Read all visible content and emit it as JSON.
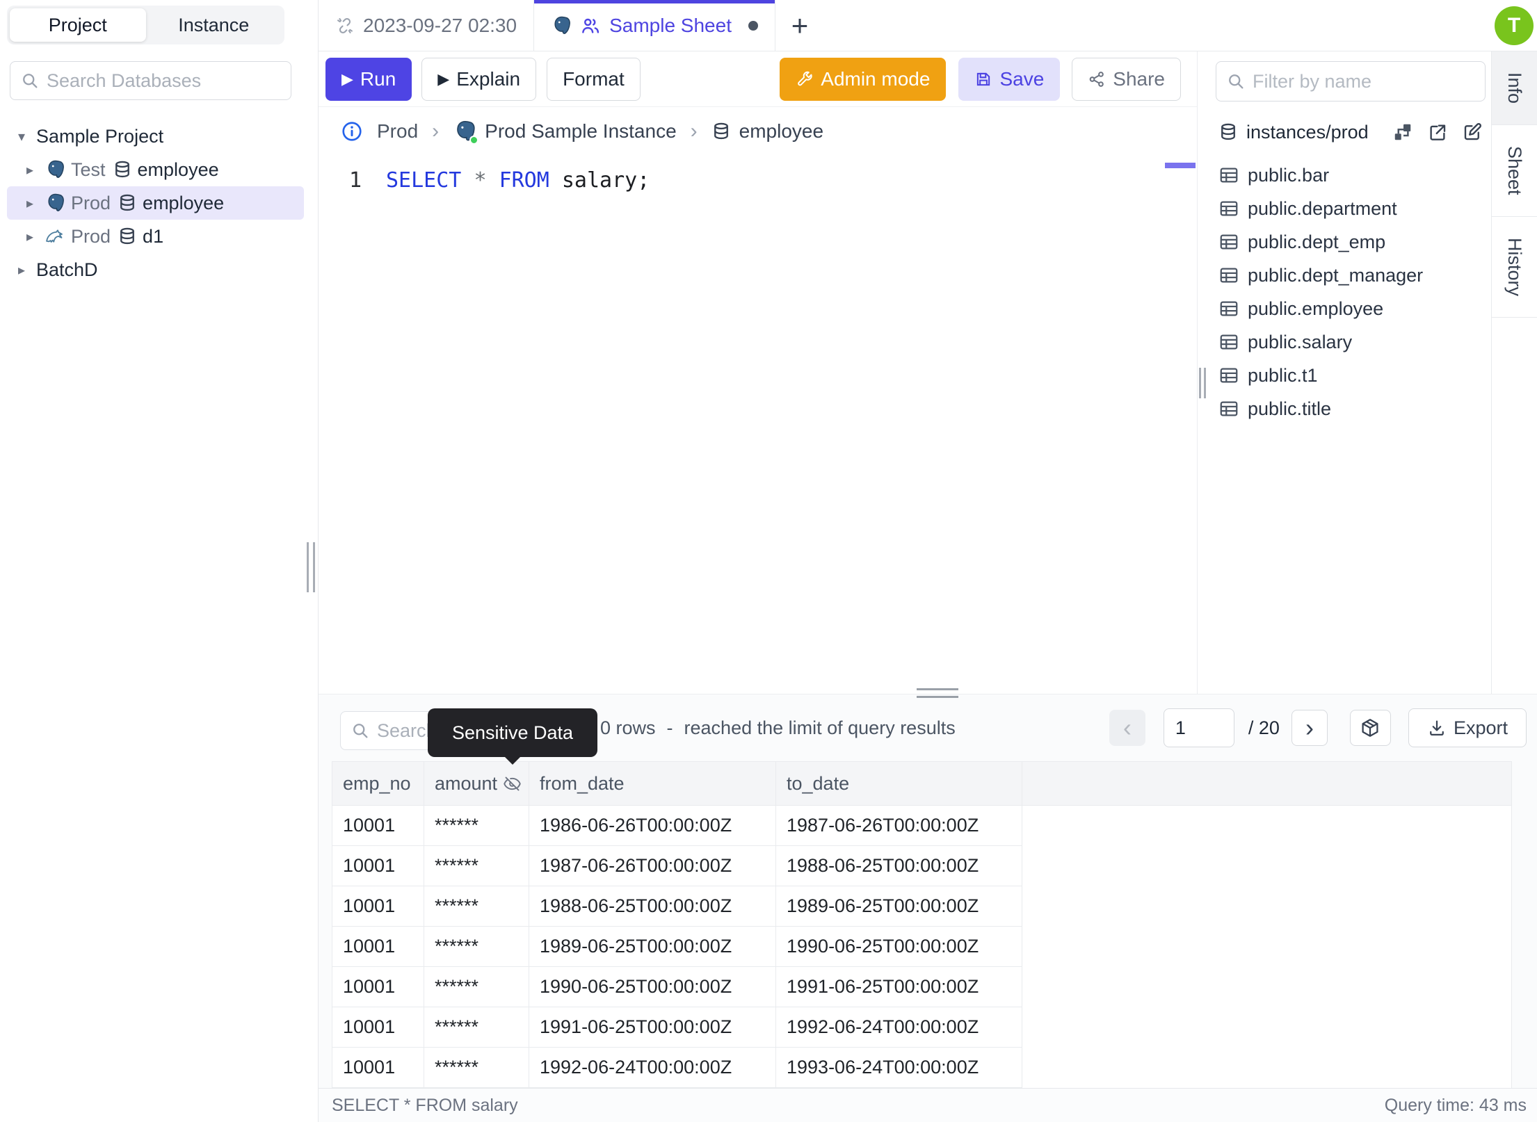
{
  "header": {
    "avatar_initial": "T"
  },
  "left_sidebar": {
    "tabs": [
      {
        "label": "Project",
        "active": true
      },
      {
        "label": "Instance",
        "active": false
      }
    ],
    "search_placeholder": "Search Databases",
    "tree": [
      {
        "kind": "project",
        "label": "Sample Project",
        "caret": "▾",
        "selected": false
      },
      {
        "kind": "database",
        "caret": "▸",
        "engine": "postgres",
        "env": "Test",
        "name": "employee",
        "selected": false
      },
      {
        "kind": "database",
        "caret": "▸",
        "engine": "postgres",
        "env": "Prod",
        "name": "employee",
        "selected": true
      },
      {
        "kind": "database",
        "caret": "▸",
        "engine": "mysql",
        "env": "Prod",
        "name": "d1",
        "selected": false
      },
      {
        "kind": "project",
        "label": "BatchD",
        "caret": "▸",
        "selected": false
      }
    ]
  },
  "tab_strip": {
    "sheet_tabs": [
      {
        "label": "2023-09-27 02:30",
        "active": false
      },
      {
        "label": "Sample Sheet",
        "active": true,
        "dirty": true
      }
    ],
    "add_tab_label": "+"
  },
  "toolbar": {
    "run_label": "Run",
    "explain_label": "Explain",
    "format_label": "Format",
    "admin_mode_label": "Admin mode",
    "save_label": "Save",
    "share_label": "Share",
    "play_glyph": "▶"
  },
  "breadcrumb": {
    "environment": "Prod",
    "separator": "›",
    "instance": "Prod Sample Instance",
    "database": "employee"
  },
  "editor": {
    "line_number": "1",
    "code_tokens": [
      {
        "text": "SELECT",
        "type": "keyword"
      },
      {
        "text": " ",
        "type": "plain"
      },
      {
        "text": "*",
        "type": "operator"
      },
      {
        "text": " ",
        "type": "plain"
      },
      {
        "text": "FROM",
        "type": "keyword"
      },
      {
        "text": " ",
        "type": "plain"
      },
      {
        "text": "salary;",
        "type": "plain"
      }
    ]
  },
  "info_panel": {
    "filter_placeholder": "Filter by name",
    "scope_label": "instances/prod",
    "tables": [
      "public.bar",
      "public.department",
      "public.dept_emp",
      "public.dept_manager",
      "public.employee",
      "public.salary",
      "public.t1",
      "public.title"
    ]
  },
  "side_rail": {
    "tabs": [
      {
        "label": "Info",
        "active": true
      },
      {
        "label": "Sheet",
        "active": false
      },
      {
        "label": "History",
        "active": false
      }
    ]
  },
  "results": {
    "search_placeholder": "Search",
    "tooltip": "Sensitive Data",
    "row_count": "0 rows",
    "separator": "-",
    "limit_message": "reached the limit of query results",
    "pagination": {
      "prev_icon": "‹",
      "current_page": "1",
      "total_label": "/ 20",
      "next_icon": "›"
    },
    "export_label": "Export",
    "table": {
      "columns": [
        "emp_no",
        "amount",
        "from_date",
        "to_date"
      ],
      "masked_column": "amount",
      "rows": [
        [
          "10001",
          "******",
          "1986-06-26T00:00:00Z",
          "1987-06-26T00:00:00Z"
        ],
        [
          "10001",
          "******",
          "1987-06-26T00:00:00Z",
          "1988-06-25T00:00:00Z"
        ],
        [
          "10001",
          "******",
          "1988-06-25T00:00:00Z",
          "1989-06-25T00:00:00Z"
        ],
        [
          "10001",
          "******",
          "1989-06-25T00:00:00Z",
          "1990-06-25T00:00:00Z"
        ],
        [
          "10001",
          "******",
          "1990-06-25T00:00:00Z",
          "1991-06-25T00:00:00Z"
        ],
        [
          "10001",
          "******",
          "1991-06-25T00:00:00Z",
          "1992-06-24T00:00:00Z"
        ],
        [
          "10001",
          "******",
          "1992-06-24T00:00:00Z",
          "1993-06-24T00:00:00Z"
        ]
      ]
    },
    "status": {
      "query": "SELECT * FROM salary",
      "time": "Query time: 43 ms"
    }
  },
  "colors": {
    "accent": "#4e44e4",
    "admin_orange": "#f0a112",
    "keyword_blue": "#2439de",
    "avatar_green": "#79c41d",
    "selection_purple": "#e9e7fb",
    "tooltip_dark": "#232327"
  }
}
